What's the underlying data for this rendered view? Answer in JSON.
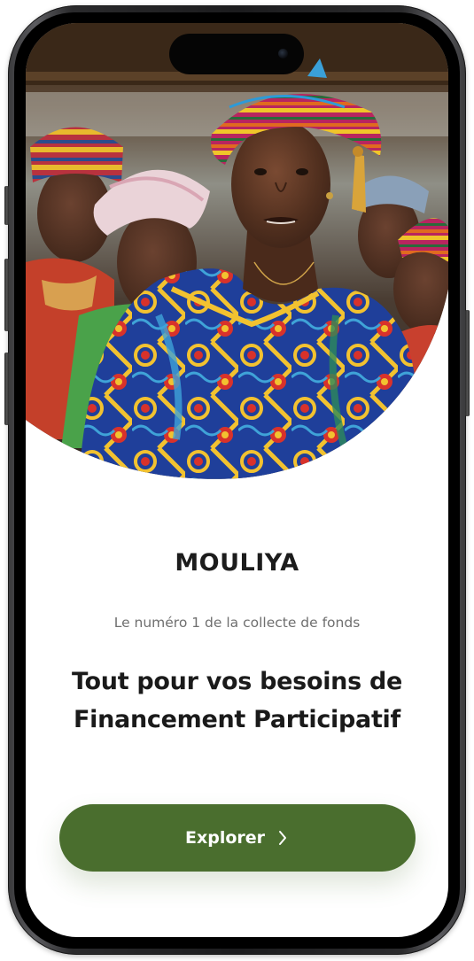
{
  "app": {
    "brand": "MOULIYA",
    "tagline": "Le numéro 1 de la collecte de fonds",
    "headline_lines": [
      "Tout pour vos besoins de",
      "Financement Participatif"
    ]
  },
  "cta": {
    "label": "Explorer",
    "icon": "chevron-right-icon"
  },
  "hero": {
    "image_subject": "women-in-colorful-african-wax-print-attire-photo"
  },
  "colors": {
    "primary": "#4a6e2e",
    "text_dark": "#1c1c1c",
    "text_muted": "#6f6f6f",
    "background": "#ffffff"
  }
}
